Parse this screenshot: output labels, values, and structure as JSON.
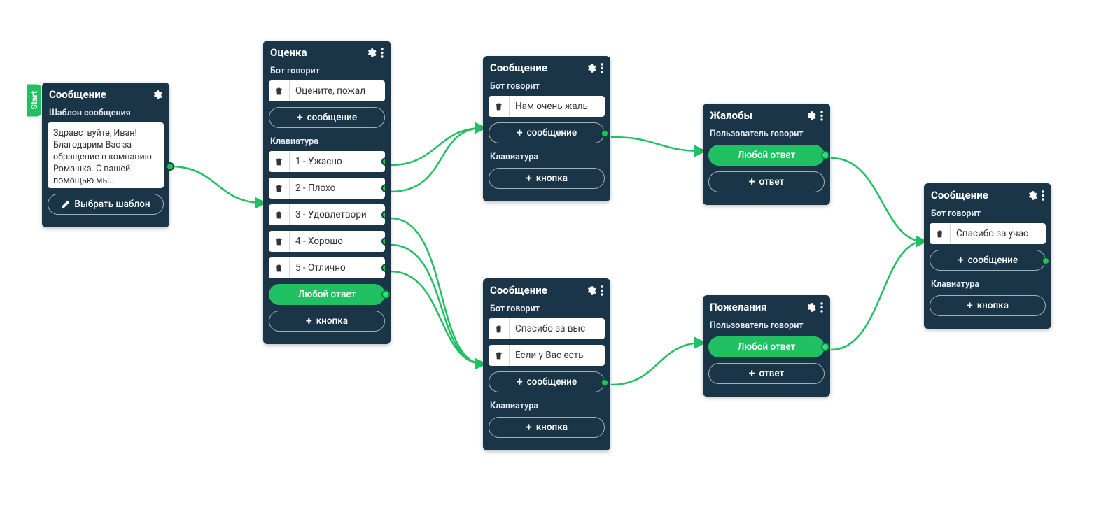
{
  "colors": {
    "accent": "#21c063",
    "node": "#1b3548"
  },
  "labels": {
    "start": "Start",
    "bot_says": "Бот говорит",
    "keyboard": "Клавиатура",
    "user_says": "Пользователь говорит",
    "add_message": "сообщение",
    "add_button": "кнопка",
    "add_answer": "ответ",
    "any_answer": "Любой ответ",
    "template_section": "Шаблон сообщения",
    "choose_template": "Выбрать шаблон"
  },
  "nodes": {
    "n1": {
      "title": "Сообщение",
      "template_preview": "Здравствуйте, Иван! Благодарим Вас за обращение в компанию Ромашка. С вашей помощью мы..."
    },
    "n2": {
      "title": "Оценка",
      "messages": [
        "Оцените, пожал"
      ],
      "buttons": [
        "1 - Ужасно",
        "2 - Плохо",
        "3 - Удовлетвори",
        "4 - Хорошо",
        "5 - Отлично"
      ]
    },
    "n3": {
      "title": "Сообщение",
      "messages": [
        "Нам очень жаль"
      ]
    },
    "n4": {
      "title": "Сообщение",
      "messages": [
        "Спасибо за выс",
        "Если у Вас есть"
      ]
    },
    "n5": {
      "title": "Жалобы"
    },
    "n6": {
      "title": "Пожелания"
    },
    "n7": {
      "title": "Сообщение",
      "messages": [
        "Спасибо за учас"
      ]
    }
  }
}
